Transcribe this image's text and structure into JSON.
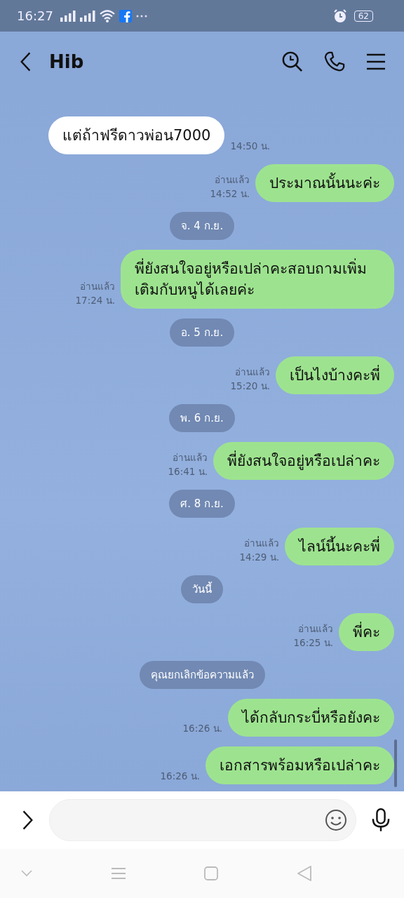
{
  "status_bar": {
    "time": "16:27",
    "battery": "62"
  },
  "header": {
    "title": "Hib"
  },
  "messages": [
    {
      "kind": "incoming",
      "text": "แต่ถ้าฟรีดาวพ่อน7000",
      "time": "14:50 น."
    },
    {
      "kind": "outgoing",
      "text": "ประมาณนั้นนะค่ะ",
      "read": "อ่านแล้ว",
      "time": "14:52 น."
    },
    {
      "kind": "date",
      "text": "จ. 4 ก.ย."
    },
    {
      "kind": "outgoing",
      "text": "พี่ยังสนใจอยู่หรือเปล่าคะสอบถามเพิ่มเติมกับหนูได้เลยค่ะ",
      "read": "อ่านแล้ว",
      "time": "17:24 น."
    },
    {
      "kind": "date",
      "text": "อ. 5 ก.ย."
    },
    {
      "kind": "outgoing",
      "text": "เป็นไงบ้างคะพี่",
      "read": "อ่านแล้ว",
      "time": "15:20 น."
    },
    {
      "kind": "date",
      "text": "พ. 6 ก.ย."
    },
    {
      "kind": "outgoing",
      "text": "พี่ยังสนใจอยู่หรือเปล่าคะ",
      "read": "อ่านแล้ว",
      "time": "16:41 น."
    },
    {
      "kind": "date",
      "text": "ศ. 8 ก.ย."
    },
    {
      "kind": "outgoing",
      "text": "ไลน์นี้นะคะพี่",
      "read": "อ่านแล้ว",
      "time": "14:29 น."
    },
    {
      "kind": "date",
      "text": "วันนี้"
    },
    {
      "kind": "outgoing",
      "text": "พี่คะ",
      "read": "อ่านแล้ว",
      "time": "16:25 น."
    },
    {
      "kind": "date",
      "text": "คุณยกเลิกข้อความแล้ว"
    },
    {
      "kind": "outgoing",
      "text": "ได้กลับกระบี่หรือยังคะ",
      "time": "16:26 น."
    },
    {
      "kind": "outgoing",
      "text": "เอกสารพร้อมหรือเปล่าคะ",
      "time": "16:26 น."
    }
  ]
}
